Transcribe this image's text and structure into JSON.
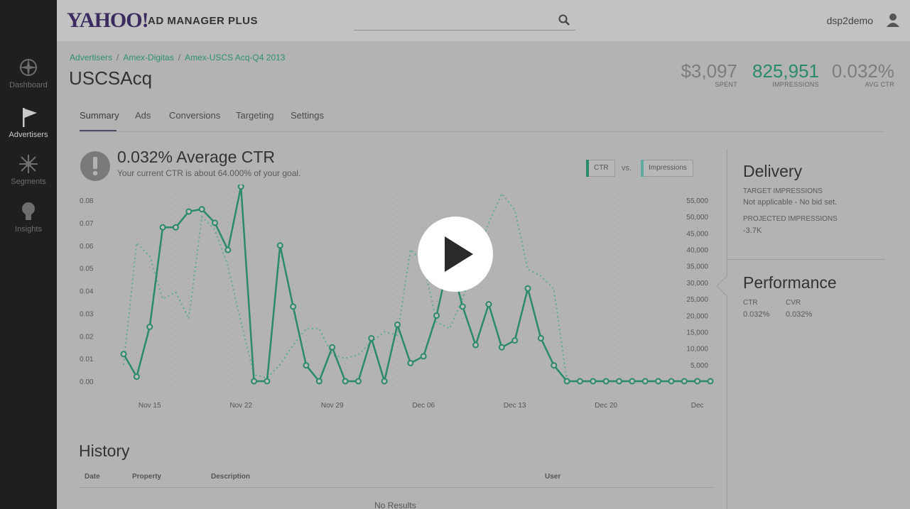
{
  "sidebar": {
    "items": [
      {
        "label": "Dashboard",
        "icon": "compass-icon"
      },
      {
        "label": "Advertisers",
        "icon": "flag-icon"
      },
      {
        "label": "Segments",
        "icon": "segments-icon"
      },
      {
        "label": "Insights",
        "icon": "lightbulb-icon"
      }
    ]
  },
  "header": {
    "logo": "YAHOO!",
    "product": "AD MANAGER PLUS",
    "search_placeholder": "",
    "user": "dsp2demo"
  },
  "breadcrumb": [
    "Advertisers",
    "Amex-Digitas",
    "Amex-USCS Acq-Q4 2013"
  ],
  "page_title": "USCSAcq",
  "stats": [
    {
      "value": "$3,097",
      "label": "SPENT"
    },
    {
      "value": "825,951",
      "label": "IMPRESSIONS"
    },
    {
      "value": "0.032%",
      "label": "AVG CTR"
    }
  ],
  "tabs": [
    "Summary",
    "Ads",
    "Conversions",
    "Targeting",
    "Settings"
  ],
  "summary": {
    "headline": "0.032% Average CTR",
    "subtext": "Your current CTR is about 64.000% of your goal.",
    "legend_ctr": "CTR",
    "legend_vs": "vs.",
    "legend_impr": "Impressions"
  },
  "colors": {
    "ctr": "#2a8a6a",
    "impressions": "#5fa89c"
  },
  "chart_data": {
    "type": "line",
    "x_tick_labels": [
      "Nov 15",
      "Nov 22",
      "Nov 29",
      "Dec 06",
      "Dec 13",
      "Dec 20",
      "Dec"
    ],
    "y_left_ticks": [
      "0.00",
      "0.01",
      "0.02",
      "0.03",
      "0.04",
      "0.05",
      "0.06",
      "0.07",
      "0.08"
    ],
    "y_right_ticks": [
      "5,000",
      "10,000",
      "15,000",
      "20,000",
      "25,000",
      "30,000",
      "35,000",
      "40,000",
      "45,000",
      "50,000",
      "55,000"
    ],
    "ylim_left": [
      0,
      0.08
    ],
    "ylim_right": [
      0,
      55000
    ],
    "series": [
      {
        "name": "CTR",
        "values": [
          0.012,
          0.002,
          0.024,
          0.068,
          0.068,
          0.075,
          0.076,
          0.07,
          0.058,
          0.086,
          0.0,
          0.0,
          0.06,
          0.033,
          0.007,
          0.0,
          0.015,
          0.0,
          0.0,
          0.019,
          0.0,
          0.025,
          0.008,
          0.011,
          0.029,
          0.055,
          0.033,
          0.016,
          0.034,
          0.015,
          0.018,
          0.041,
          0.019,
          0.007,
          0.0,
          0.0,
          0.0,
          0.0,
          0.0,
          0.0,
          0.0,
          0.0,
          0.0,
          0.0,
          0.0,
          0.0
        ]
      },
      {
        "name": "Impressions",
        "values": [
          5000,
          42000,
          38000,
          25000,
          27000,
          19000,
          50000,
          46000,
          35000,
          18000,
          2000,
          1000,
          5000,
          11000,
          16000,
          16000,
          8000,
          7000,
          8000,
          12000,
          15000,
          14000,
          40000,
          36000,
          18000,
          16000,
          25000,
          38000,
          48000,
          57000,
          52000,
          34000,
          32000,
          28000,
          0,
          0,
          0,
          0,
          0,
          0,
          0,
          0,
          0,
          0,
          0,
          0
        ]
      }
    ]
  },
  "delivery": {
    "title": "Delivery",
    "target_label": "TARGET IMPRESSIONS",
    "target_value": "Not applicable - No bid set.",
    "projected_label": "PROJECTED IMPRESSIONS",
    "projected_value": "-3.7K"
  },
  "performance": {
    "title": "Performance",
    "ctr_label": "CTR",
    "ctr_value": "0.032%",
    "cvr_label": "CVR",
    "cvr_value": "0.032%"
  },
  "history": {
    "title": "History",
    "columns": [
      "Date",
      "Property",
      "Description",
      "User"
    ],
    "empty": "No Results"
  }
}
